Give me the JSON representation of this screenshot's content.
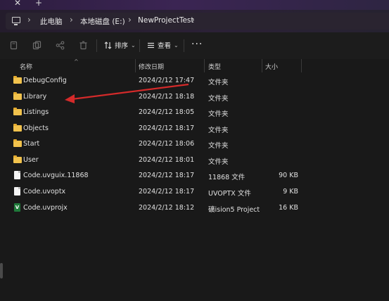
{
  "window": {
    "close_glyph": "✕",
    "new_tab_glyph": "+"
  },
  "address": {
    "icon": "computer-icon",
    "breadcrumbs": [
      "此电脑",
      "本地磁盘 (E:)",
      "NewProjectTest"
    ]
  },
  "toolbar": {
    "sort_label": "排序",
    "view_label": "查看",
    "more_label": "···"
  },
  "columns": {
    "name": "名称",
    "date": "修改日期",
    "type": "类型",
    "size": "大小"
  },
  "files": [
    {
      "name": "DebugConfig",
      "date": "2024/2/12 17:47",
      "type": "文件夹",
      "size": "",
      "icon": "folder-icon"
    },
    {
      "name": "Library",
      "date": "2024/2/12 18:18",
      "type": "文件夹",
      "size": "",
      "icon": "folder-icon"
    },
    {
      "name": "Listings",
      "date": "2024/2/12 18:05",
      "type": "文件夹",
      "size": "",
      "icon": "folder-icon"
    },
    {
      "name": "Objects",
      "date": "2024/2/12 18:17",
      "type": "文件夹",
      "size": "",
      "icon": "folder-icon"
    },
    {
      "name": "Start",
      "date": "2024/2/12 18:06",
      "type": "文件夹",
      "size": "",
      "icon": "folder-icon"
    },
    {
      "name": "User",
      "date": "2024/2/12 18:01",
      "type": "文件夹",
      "size": "",
      "icon": "folder-icon"
    },
    {
      "name": "Code.uvguix.11868",
      "date": "2024/2/12 18:17",
      "type": "11868 文件",
      "size": "90 KB",
      "icon": "file-icon"
    },
    {
      "name": "Code.uvoptx",
      "date": "2024/2/12 18:17",
      "type": "UVOPTX 文件",
      "size": "9 KB",
      "icon": "file-icon"
    },
    {
      "name": "Code.uvprojx",
      "date": "2024/2/12 18:12",
      "type": "礦ision5 Project",
      "size": "16 KB",
      "icon": "keil-project-icon"
    }
  ],
  "colors": {
    "folder": "#f1c24d",
    "annotation_arrow": "#d42a2a"
  }
}
